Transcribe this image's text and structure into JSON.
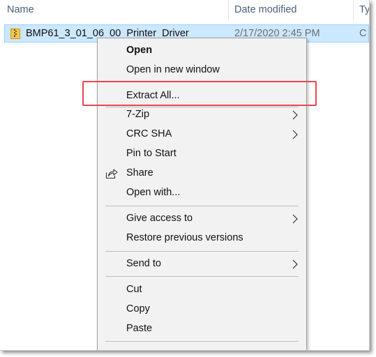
{
  "header": {
    "col_name": "Name",
    "col_date": "Date modified",
    "col_type": "Ty"
  },
  "file": {
    "name": "BMP61_3_01_06_00_Printer_Driver",
    "date": "2/17/2020 2:45 PM",
    "type": "C",
    "icon": "zip-folder-icon"
  },
  "context_menu": {
    "open": "Open",
    "open_new_window": "Open in new window",
    "extract_all": "Extract All...",
    "seven_zip": "7-Zip",
    "crc_sha": "CRC SHA",
    "pin_to_start": "Pin to Start",
    "share": "Share",
    "open_with": "Open with...",
    "give_access": "Give access to",
    "restore_versions": "Restore previous versions",
    "send_to": "Send to",
    "cut": "Cut",
    "copy": "Copy",
    "paste": "Paste"
  },
  "colors": {
    "selection_bg": "#cce8ff",
    "highlight_border": "#e8474e",
    "menu_bg": "#f2f2f2"
  }
}
